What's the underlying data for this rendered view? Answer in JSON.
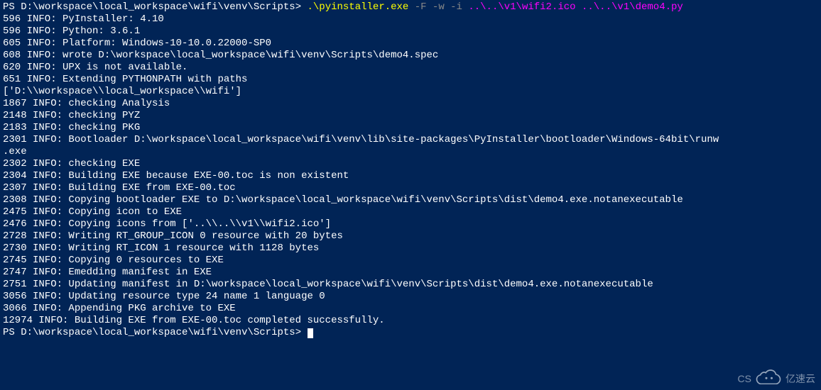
{
  "prompt": {
    "ps_prefix": "PS ",
    "path": "D:\\workspace\\local_workspace\\wifi\\venv\\Scripts",
    "sep": "> ",
    "cmd_exe": ".\\pyinstaller.exe",
    "flags": " -F -w -i ",
    "args": "..\\..\\v1\\wifi2.ico ..\\..\\v1\\demo4.py"
  },
  "output": [
    "596 INFO: PyInstaller: 4.10",
    "596 INFO: Python: 3.6.1",
    "605 INFO: Platform: Windows-10-10.0.22000-SP0",
    "608 INFO: wrote D:\\workspace\\local_workspace\\wifi\\venv\\Scripts\\demo4.spec",
    "620 INFO: UPX is not available.",
    "651 INFO: Extending PYTHONPATH with paths",
    "['D:\\\\workspace\\\\local_workspace\\\\wifi']",
    "1867 INFO: checking Analysis",
    "2148 INFO: checking PYZ",
    "2183 INFO: checking PKG",
    "2301 INFO: Bootloader D:\\workspace\\local_workspace\\wifi\\venv\\lib\\site-packages\\PyInstaller\\bootloader\\Windows-64bit\\runw",
    ".exe",
    "2302 INFO: checking EXE",
    "2304 INFO: Building EXE because EXE-00.toc is non existent",
    "2307 INFO: Building EXE from EXE-00.toc",
    "2308 INFO: Copying bootloader EXE to D:\\workspace\\local_workspace\\wifi\\venv\\Scripts\\dist\\demo4.exe.notanexecutable",
    "2475 INFO: Copying icon to EXE",
    "2476 INFO: Copying icons from ['..\\\\..\\\\v1\\\\wifi2.ico']",
    "2728 INFO: Writing RT_GROUP_ICON 0 resource with 20 bytes",
    "2730 INFO: Writing RT_ICON 1 resource with 1128 bytes",
    "2745 INFO: Copying 0 resources to EXE",
    "2747 INFO: Emedding manifest in EXE",
    "2751 INFO: Updating manifest in D:\\workspace\\local_workspace\\wifi\\venv\\Scripts\\dist\\demo4.exe.notanexecutable",
    "3056 INFO: Updating resource type 24 name 1 language 0",
    "3066 INFO: Appending PKG archive to EXE",
    "12974 INFO: Building EXE from EXE-00.toc completed successfully."
  ],
  "prompt2": {
    "ps_prefix": "PS ",
    "path": "D:\\workspace\\local_workspace\\wifi\\venv\\Scripts",
    "sep": "> "
  },
  "watermark": {
    "left_text": "CS",
    "brand": "亿速云"
  }
}
